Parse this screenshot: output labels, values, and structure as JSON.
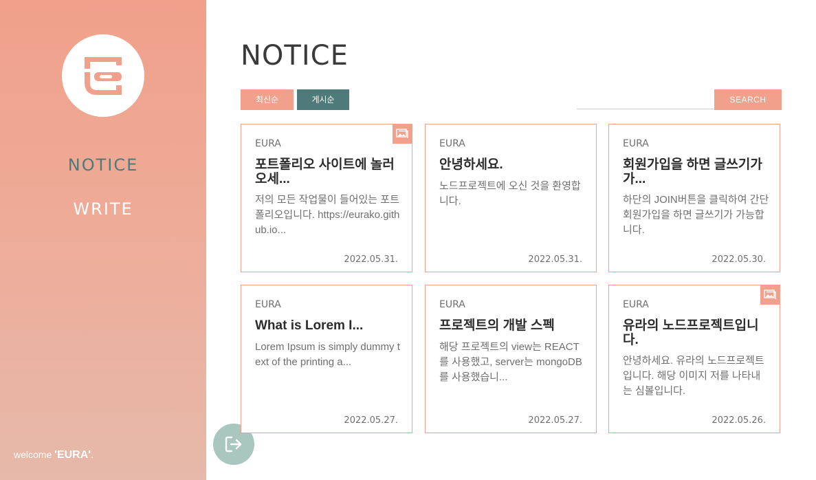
{
  "sidebar": {
    "nav": {
      "notice": "NOTICE",
      "write": "WRITE"
    },
    "welcome": {
      "prefix": "welcome",
      "username": "'EURA'",
      "suffix": "."
    }
  },
  "main": {
    "title": "NOTICE",
    "sort": {
      "latest": "최신순",
      "posting": "게시순"
    },
    "search": {
      "button": "SEARCH",
      "placeholder": ""
    }
  },
  "cards": [
    {
      "author": "EURA",
      "title": "포트폴리오 사이트에 놀러오세...",
      "body": "저의 모든 작업물이 들어있는 포트폴리오입니다. https://eurako.github.io...",
      "date": "2022.05.31.",
      "has_image": true
    },
    {
      "author": "EURA",
      "title": "안녕하세요.",
      "body": "노드프로젝트에 오신 것을 환영합니다.",
      "date": "2022.05.31.",
      "has_image": false
    },
    {
      "author": "EURA",
      "title": "회원가입을 하면 글쓰기가 가...",
      "body": "하단의 JOIN버튼을 클릭하여 간단 회원가입을 하면 글쓰기가 가능합니다.",
      "date": "2022.05.30.",
      "has_image": false
    },
    {
      "author": "EURA",
      "title": "What is Lorem I...",
      "body": "Lorem Ipsum is simply dummy text of the printing a...",
      "date": "2022.05.27.",
      "has_image": false
    },
    {
      "author": "EURA",
      "title": "프로젝트의 개발 스펙",
      "body": "해당 프로젝트의 view는 REACT를 사용했고, server는 mongoDB를 사용했습니...",
      "date": "2022.05.27.",
      "has_image": false
    },
    {
      "author": "EURA",
      "title": "유라의 노드프로젝트입니다.",
      "body": "안녕하세요. 유라의 노드프로젝트입니다. 해당 이미지 저를 나타내는 심볼입니다.",
      "date": "2022.05.26.",
      "has_image": true
    }
  ],
  "icons": {
    "logo": "eura-logo-icon",
    "image_badge": "image-icon",
    "logout": "logout-icon"
  },
  "colors": {
    "accent": "#f0a08b",
    "teal": "#4e7b79",
    "logout_bg": "#a9c6bf"
  }
}
